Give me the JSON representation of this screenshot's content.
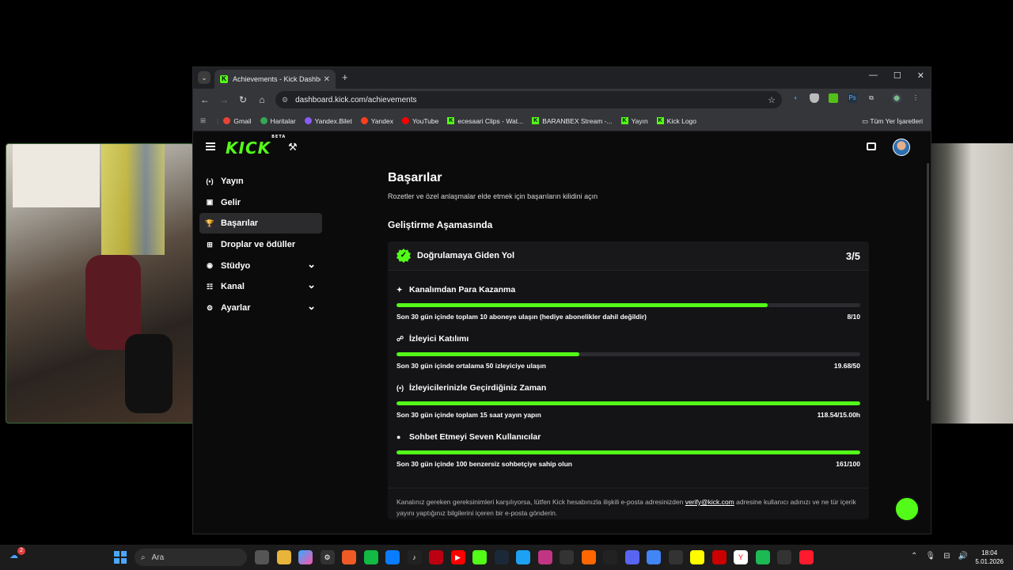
{
  "browser": {
    "tab_title": "Achievements - Kick Dashboard",
    "tab_close": "✕",
    "new_tab": "+",
    "url": "dashboard.kick.com/achievements",
    "bookmarks": [
      {
        "label": "Gmail",
        "icon": "gmail-icon",
        "color": "#ea4335",
        "kick": false
      },
      {
        "label": "Haritalar",
        "icon": "maps-icon",
        "color": "#34a853",
        "kick": false
      },
      {
        "label": "Yandex.Bilet",
        "icon": "yandex-bilet-icon",
        "color": "#8a5cf6",
        "kick": false
      },
      {
        "label": "Yandex",
        "icon": "yandex-icon",
        "color": "#fc3f1d",
        "kick": false
      },
      {
        "label": "YouTube",
        "icon": "youtube-icon",
        "color": "#ff0000",
        "kick": false
      },
      {
        "label": "ecesaari Clips - Wat...",
        "icon": "kick-icon",
        "color": "#53fc18",
        "kick": true
      },
      {
        "label": "BARANBEX Stream -...",
        "icon": "kick-icon",
        "color": "#53fc18",
        "kick": true
      },
      {
        "label": "Yayın",
        "icon": "kick-icon",
        "color": "#53fc18",
        "kick": true
      },
      {
        "label": "Kick Logo",
        "icon": "kick-icon",
        "color": "#53fc18",
        "kick": true
      }
    ],
    "bookmarks_all": "Tüm Yer İşaretleri"
  },
  "kick": {
    "logo": "KICK",
    "logo_beta": "BETA",
    "accent": "#53fc18"
  },
  "sidebar": {
    "items": [
      {
        "label": "Yayın",
        "icon": "broadcast-icon",
        "glyph": "(•)",
        "active": false,
        "expandable": false
      },
      {
        "label": "Gelir",
        "icon": "revenue-icon",
        "glyph": "▣",
        "active": false,
        "expandable": false
      },
      {
        "label": "Başarılar",
        "icon": "trophy-icon",
        "glyph": "🏆",
        "active": true,
        "expandable": false
      },
      {
        "label": "Droplar ve ödüller",
        "icon": "gift-drops-icon",
        "glyph": "⊞",
        "active": false,
        "expandable": false
      },
      {
        "label": "Stüdyo",
        "icon": "studio-icon",
        "glyph": "◉",
        "active": false,
        "expandable": true
      },
      {
        "label": "Kanal",
        "icon": "channel-icon",
        "glyph": "☷",
        "active": false,
        "expandable": true
      },
      {
        "label": "Ayarlar",
        "icon": "settings-icon",
        "glyph": "⚙",
        "active": false,
        "expandable": true
      }
    ]
  },
  "main": {
    "title": "Başarılar",
    "subtitle": "Rozetler ve özel anlaşmalar elde etmek için başarıların kilidini açın",
    "section_title": "Geliştirme Aşamasında",
    "card": {
      "title": "Doğrulamaya Giden Yol",
      "count": "3/5",
      "items": [
        {
          "title": "Kanalımdan Para Kazanma",
          "icon": "sparkle-icon",
          "glyph": "✦",
          "desc": "Son 30 gün içinde toplam 10 aboneye ulaşın (hediye abonelikler dahil değildir)",
          "value": "8/10",
          "progress": 0.8
        },
        {
          "title": "İzleyici Katılımı",
          "icon": "viewers-icon",
          "glyph": "☍",
          "desc": "Son 30 gün içinde ortalama 50 izleyiciye ulaşın",
          "value": "19.68/50",
          "progress": 0.3936
        },
        {
          "title": "İzleyicilerinizle Geçirdiğiniz Zaman",
          "icon": "broadcast-icon",
          "glyph": "(•)",
          "desc": "Son 30 gün içinde toplam 15 saat yayın yapın",
          "value": "118.54/15.00h",
          "progress": 1.0
        },
        {
          "title": "Sohbet Etmeyi Seven Kullanıcılar",
          "icon": "chat-icon",
          "glyph": "●",
          "desc": "Son 30 gün içinde 100 benzersiz sohbetçiye sahip olun",
          "value": "161/100",
          "progress": 1.0
        }
      ],
      "footnote_before": "Kanalınız gereken gereksinimleri karşılıyorsa, lütfen Kick hesabınızla ilişkili e-posta adresinizden ",
      "footnote_link": "verify@kick.com",
      "footnote_after": " adresine kullanıcı adınızı ve ne tür içerik yayını yaptığınız bilgilerini içeren bir e-posta gönderin."
    }
  },
  "taskbar": {
    "search_placeholder": "Ara",
    "weather_badge": "2",
    "time": "18:04",
    "date": "5.01.2026"
  }
}
